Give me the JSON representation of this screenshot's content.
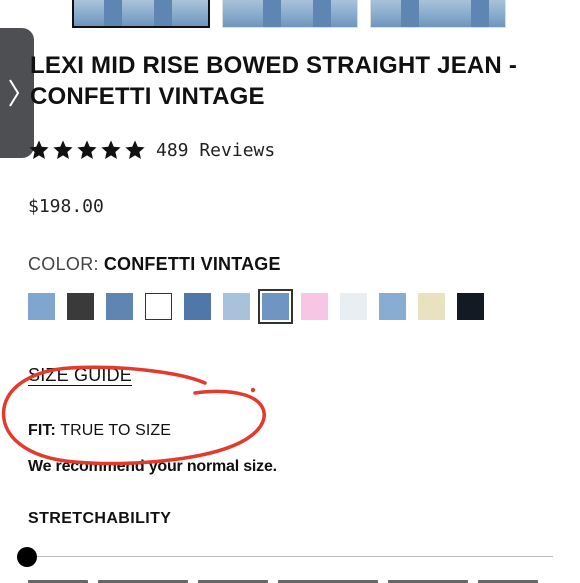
{
  "product": {
    "title": "LEXI MID RISE BOWED STRAIGHT JEAN - CONFETTI VINTAGE",
    "rating": 5,
    "reviews_label": "489 Reviews",
    "price": "$198.00",
    "color_label": "COLOR:",
    "color_value": "CONFETTI VINTAGE"
  },
  "swatches": [
    {
      "color": "#7fa6cf"
    },
    {
      "color": "#3a3a3a"
    },
    {
      "color": "#5f86b3"
    },
    {
      "color": "#ffffff"
    },
    {
      "color": "#4f78a8"
    },
    {
      "color": "#a8c2dc"
    },
    {
      "color": "#6f96c2",
      "selected": true
    },
    {
      "color": "#f7c6e4"
    },
    {
      "color": "#e9eef3"
    },
    {
      "color": "#89acd2"
    },
    {
      "color": "#e9e2bf"
    },
    {
      "color": "#141a24"
    }
  ],
  "size_guide_label": "SIZE GUIDE",
  "fit": {
    "label": "FIT:",
    "value": "TRUE TO SIZE",
    "recommendation": "We recommend your normal size."
  },
  "stretchability_label": "STRETCHABILITY",
  "stretchability_level": 0,
  "annotation_color": "#e23a2b",
  "icons": {
    "side_tab": "chevron-right-icon",
    "rating": "star-icon"
  }
}
